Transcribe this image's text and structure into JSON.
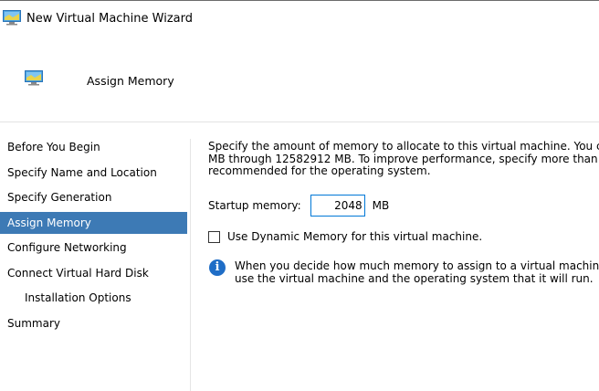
{
  "window": {
    "title": "New Virtual Machine Wizard"
  },
  "header": {
    "title": "Assign Memory"
  },
  "nav": {
    "items": [
      {
        "label": "Before You Begin",
        "selected": false
      },
      {
        "label": "Specify Name and Location",
        "selected": false
      },
      {
        "label": "Specify Generation",
        "selected": false
      },
      {
        "label": "Assign Memory",
        "selected": true
      },
      {
        "label": "Configure Networking",
        "selected": false
      },
      {
        "label": "Connect Virtual Hard Disk",
        "selected": false
      },
      {
        "label": "Installation Options",
        "selected": false
      },
      {
        "label": "Summary",
        "selected": false
      }
    ]
  },
  "main": {
    "description_lines": [
      "Specify the amount of memory to allocate to this virtual machine. You ca",
      "MB through 12582912 MB. To improve performance, specify more than",
      "recommended for the operating system."
    ],
    "startup_memory_label": "Startup memory:",
    "startup_memory_value": "2048",
    "startup_memory_unit": "MB",
    "dynamic_memory_label": "Use Dynamic Memory for this virtual machine.",
    "dynamic_memory_checked": false,
    "info_lines": [
      "When you decide how much memory to assign to a virtual machine,",
      "use the virtual machine and the operating system that it will run."
    ]
  },
  "icons": {
    "window_icon": "virtual-machine-icon",
    "header_icon": "virtual-machine-icon",
    "info_icon": "info-icon"
  },
  "colors": {
    "selection": "#3d7ab5",
    "info": "#1f6dc6",
    "input_border": "#0078d7"
  }
}
